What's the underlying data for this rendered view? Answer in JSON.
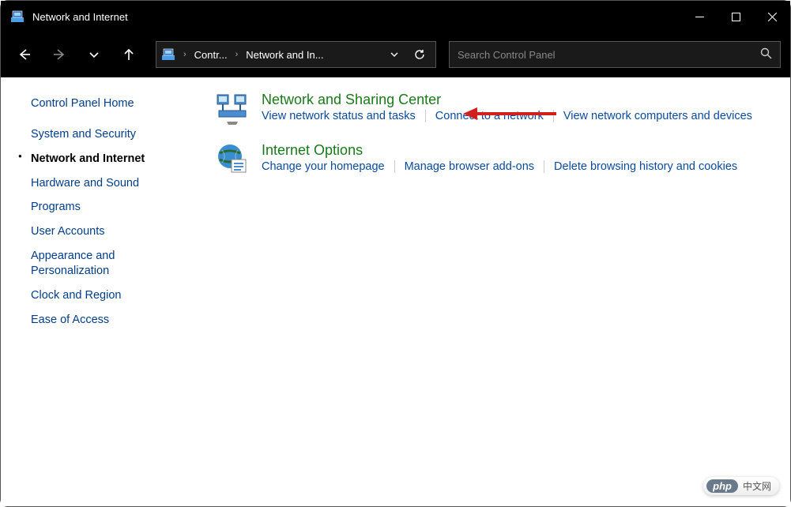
{
  "window": {
    "title": "Network and Internet"
  },
  "address": {
    "crumb1": "Contr...",
    "crumb2": "Network and In..."
  },
  "search": {
    "placeholder": "Search Control Panel"
  },
  "sidebar": {
    "home": "Control Panel Home",
    "items": [
      {
        "label": "System and Security"
      },
      {
        "label": "Network and Internet"
      },
      {
        "label": "Hardware and Sound"
      },
      {
        "label": "Programs"
      },
      {
        "label": "User Accounts"
      },
      {
        "label": "Appearance and Personalization"
      },
      {
        "label": "Clock and Region"
      },
      {
        "label": "Ease of Access"
      }
    ]
  },
  "categories": [
    {
      "title": "Network and Sharing Center",
      "links": [
        "View network status and tasks",
        "Connect to a network",
        "View network computers and devices"
      ]
    },
    {
      "title": "Internet Options",
      "links": [
        "Change your homepage",
        "Manage browser add-ons",
        "Delete browsing history and cookies"
      ]
    }
  ],
  "watermark": {
    "badge": "php",
    "text": "中文网"
  }
}
